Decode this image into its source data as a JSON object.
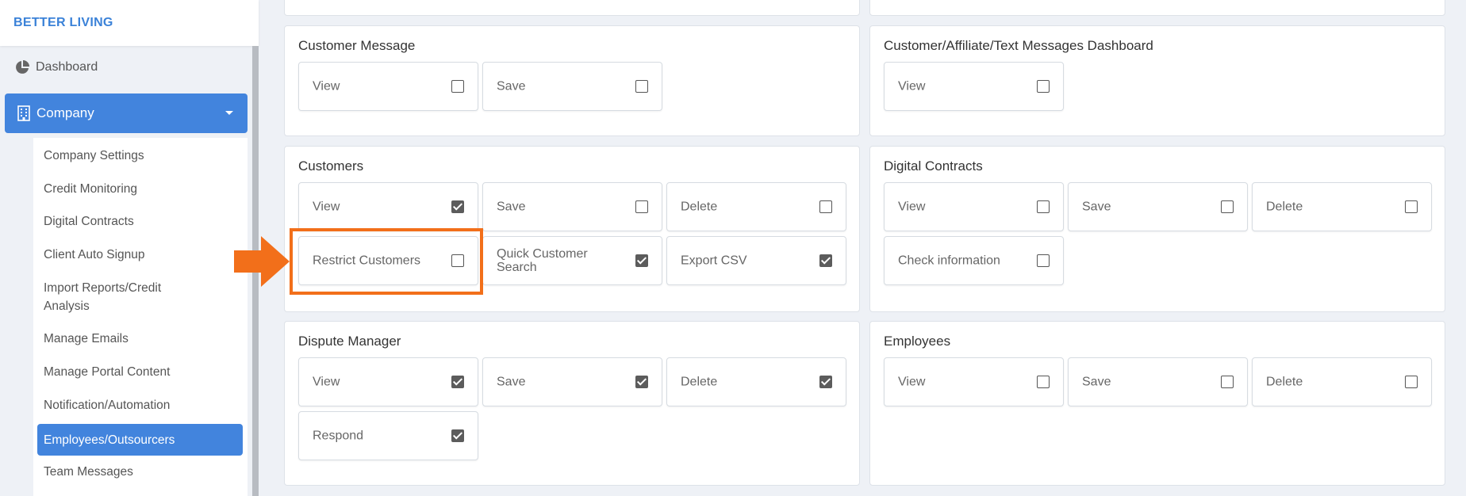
{
  "brand": {
    "name": "BETTER LIVING"
  },
  "sidebar": {
    "dashboard": "Dashboard",
    "company": "Company",
    "submenu": [
      {
        "label": "Company Settings"
      },
      {
        "label": "Credit Monitoring"
      },
      {
        "label": "Digital Contracts"
      },
      {
        "label": "Client Auto Signup"
      },
      {
        "label": "Import Reports/Credit Analysis"
      },
      {
        "label": "Manage Emails"
      },
      {
        "label": "Manage Portal Content"
      },
      {
        "label": "Notification/Automation"
      },
      {
        "label": "Employees/Outsourcers",
        "active": true
      },
      {
        "label": "Team Messages"
      }
    ]
  },
  "sections": {
    "customer_message": {
      "title": "Customer Message",
      "perms": [
        {
          "label": "View",
          "checked": false
        },
        {
          "label": "Save",
          "checked": false
        }
      ]
    },
    "customer_dashboard": {
      "title": "Customer/Affiliate/Text Messages Dashboard",
      "perms": [
        {
          "label": "View",
          "checked": false
        }
      ]
    },
    "customers": {
      "title": "Customers",
      "perms": [
        {
          "label": "View",
          "checked": true
        },
        {
          "label": "Save",
          "checked": false
        },
        {
          "label": "Delete",
          "checked": false
        },
        {
          "label": "Restrict Customers",
          "checked": false
        },
        {
          "label": "Quick Customer Search",
          "checked": true
        },
        {
          "label": "Export CSV",
          "checked": true
        }
      ]
    },
    "digital_contracts": {
      "title": "Digital Contracts",
      "perms": [
        {
          "label": "View",
          "checked": false
        },
        {
          "label": "Save",
          "checked": false
        },
        {
          "label": "Delete",
          "checked": false
        },
        {
          "label": "Check information",
          "checked": false
        }
      ]
    },
    "dispute_manager": {
      "title": "Dispute Manager",
      "perms": [
        {
          "label": "View",
          "checked": true
        },
        {
          "label": "Save",
          "checked": true
        },
        {
          "label": "Delete",
          "checked": true
        },
        {
          "label": "Respond",
          "checked": true
        }
      ]
    },
    "employees": {
      "title": "Employees",
      "perms": [
        {
          "label": "View",
          "checked": false
        },
        {
          "label": "Save",
          "checked": false
        },
        {
          "label": "Delete",
          "checked": false
        }
      ]
    }
  },
  "colors": {
    "accent": "#4284dd",
    "highlight": "#f26f1a"
  }
}
